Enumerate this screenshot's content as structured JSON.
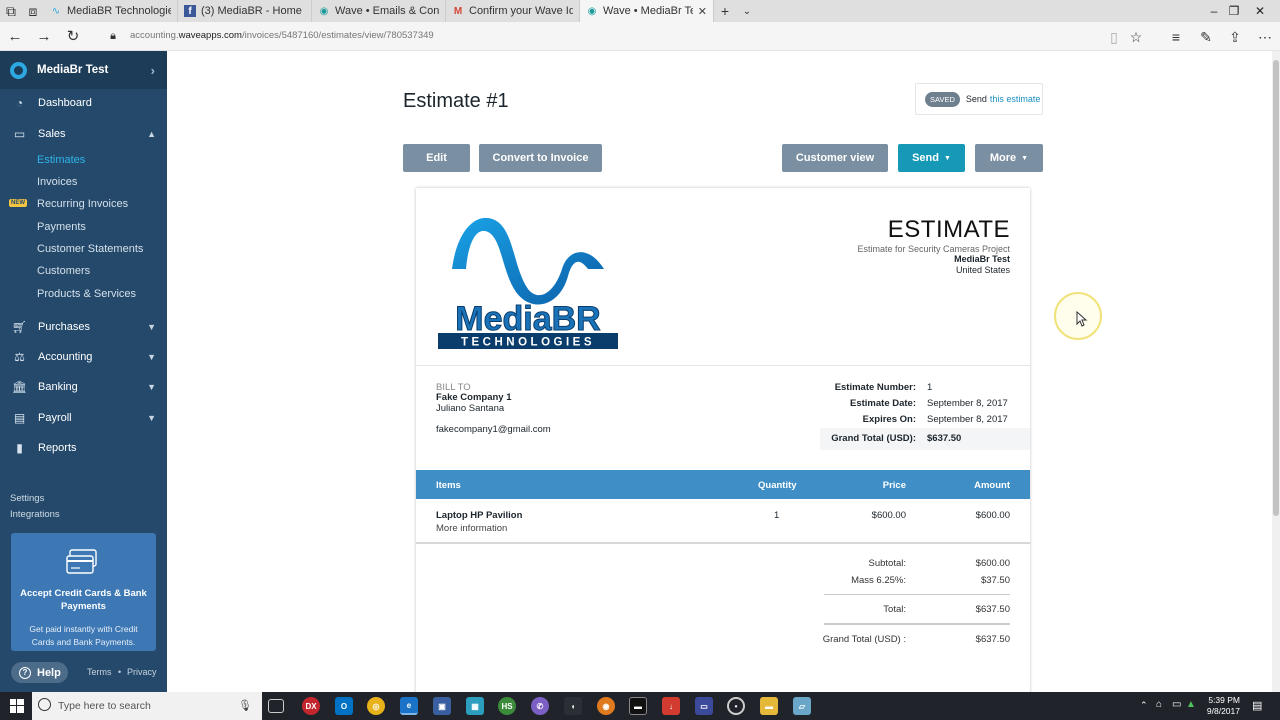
{
  "browser": {
    "tabs": [
      {
        "title": "MediaBR Technologies – Pro",
        "icon": "wave-icon",
        "active": false
      },
      {
        "title": "(3) MediaBR - Home",
        "icon": "facebook-icon",
        "active": false
      },
      {
        "title": "Wave • Emails & Connected",
        "icon": "wave-icon",
        "active": false
      },
      {
        "title": "Confirm your Wave Identity",
        "icon": "gmail-icon",
        "active": false
      },
      {
        "title": "Wave • MediaBr Test • E",
        "icon": "wave-icon",
        "active": true
      }
    ],
    "url_prefix": "accounting.",
    "url_domain": "waveapps.com",
    "url_path": "/invoices/5487160/estimates/view/780537349"
  },
  "sidebar": {
    "business_name": "MediaBr Test",
    "nav": {
      "dashboard": "Dashboard",
      "sales": "Sales",
      "purchases": "Purchases",
      "accounting": "Accounting",
      "banking": "Banking",
      "payroll": "Payroll",
      "reports": "Reports"
    },
    "sales_items": [
      "Estimates",
      "Invoices",
      "Recurring Invoices",
      "Payments",
      "Customer Statements",
      "Customers",
      "Products & Services"
    ],
    "new_badge": "NEW",
    "settings": "Settings",
    "integrations": "Integrations",
    "promo_title": "Accept Credit Cards & Bank Payments",
    "promo_desc": "Get paid instantly with Credit Cards and Bank Payments.",
    "help": "Help",
    "terms": "Terms",
    "privacy": "Privacy"
  },
  "header": {
    "title": "Estimate #1",
    "saved_badge": "SAVED",
    "send_text": "Send",
    "send_link": "this estimate"
  },
  "toolbar": {
    "edit": "Edit",
    "convert": "Convert to Invoice",
    "customer_view": "Customer view",
    "send": "Send",
    "more": "More"
  },
  "estimate": {
    "heading": "ESTIMATE",
    "subtitle": "Estimate for Security Cameras Project",
    "company": "MediaBr Test",
    "country": "United States",
    "logo_main": "MediaBR",
    "logo_sub": "TECHNOLOGIES",
    "bill_to_label": "BILL TO",
    "bill_company": "Fake Company 1",
    "bill_contact": "Juliano Santana",
    "bill_email": "fakecompany1@gmail.com",
    "number_label": "Estimate Number:",
    "number": "1",
    "date_label": "Estimate Date:",
    "date": "September 8, 2017",
    "expires_label": "Expires On:",
    "expires": "September 8, 2017",
    "grand_label": "Grand Total (USD):",
    "grand": "$637.50",
    "columns": {
      "items": "Items",
      "quantity": "Quantity",
      "price": "Price",
      "amount": "Amount"
    },
    "line_items": [
      {
        "name": "Laptop HP Pavilion",
        "desc": "More information",
        "quantity": "1",
        "price": "$600.00",
        "amount": "$600.00"
      }
    ],
    "subtotal_label": "Subtotal:",
    "subtotal": "$600.00",
    "tax_label": "Mass 6.25%:",
    "tax": "$37.50",
    "total_label": "Total:",
    "total": "$637.50",
    "grand_total_label": "Grand Total (USD) :",
    "grand_total": "$637.50"
  },
  "taskbar": {
    "search_placeholder": "Type here to search",
    "time": "5:39 PM",
    "date": "9/8/2017"
  },
  "colors": {
    "sidebar": "#24496b",
    "accent": "#1599b6",
    "table_header": "#3f8fc6",
    "secondary_button": "#7b8fa2"
  }
}
